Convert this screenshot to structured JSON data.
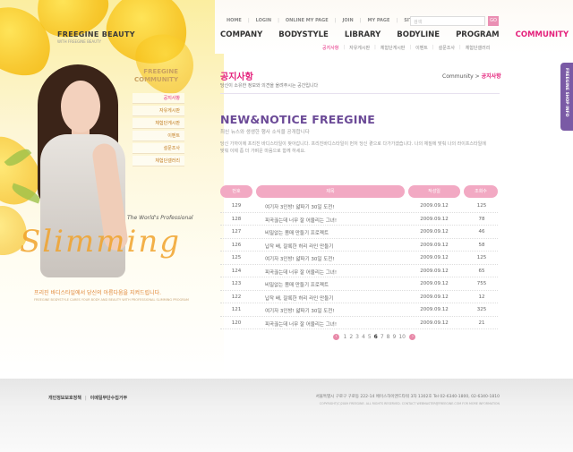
{
  "brand": {
    "name": "FREEGINE BEAUTY",
    "tagline": "WITH FREEGINE BEAUTY"
  },
  "util_nav": [
    "HOME",
    "LOGIN",
    "ONLINE MY PAGE",
    "JOIN",
    "MY PAGE",
    "SITEMAP"
  ],
  "search": {
    "placeholder": "검색",
    "button": "GO"
  },
  "main_nav": [
    {
      "label": "COMPANY",
      "active": false
    },
    {
      "label": "BODYSTYLE",
      "active": false
    },
    {
      "label": "LIBRARY",
      "active": false
    },
    {
      "label": "BODYLINE",
      "active": false
    },
    {
      "label": "PROGRAM",
      "active": false
    },
    {
      "label": "COMMUNITY",
      "active": true
    }
  ],
  "sub_nav": [
    {
      "label": "공지사항",
      "active": true
    },
    {
      "label": "자유게시판",
      "active": false
    },
    {
      "label": "체험단게시판",
      "active": false
    },
    {
      "label": "이벤트",
      "active": false
    },
    {
      "label": "설문조사",
      "active": false
    },
    {
      "label": "체험단갤러리",
      "active": false
    }
  ],
  "community": {
    "title_line1": "FREEGINE",
    "title_line2": "COMMUNITY",
    "menu": [
      {
        "label": "공지사항",
        "active": true
      },
      {
        "label": "자유게시판",
        "active": false
      },
      {
        "label": "체험단게시판",
        "active": false
      },
      {
        "label": "이벤트",
        "active": false
      },
      {
        "label": "설문조사",
        "active": false
      },
      {
        "label": "체험단갤러리",
        "active": false
      }
    ]
  },
  "slimming": {
    "small": "The World's Professional",
    "big": "Slimming",
    "caption": "프리진 바디스타일에서 당신의 아름다움을 지켜드립니다.",
    "caption_sub": "FREEGINE BODYSTYLE CARES YOUR BODY AND BEAUTY WITH PROFESSIONAL SLIMMING PROGRAM"
  },
  "page": {
    "title": "공지사항",
    "subtitle": "당신이 소유한 정보와 의견을 올려주시는 공간입니다",
    "breadcrumb_parent": "Community",
    "breadcrumb_sep": ">",
    "breadcrumb_current": "공지사항"
  },
  "notice": {
    "title": "NEW&NOTICE FREEGINE",
    "subtitle": "최신 뉴스와 생생한 행사 소식을 공개합니다",
    "desc": "당신 가까이에 프리진 바디스타일이 찾아갑니다. 프리진바디스타일이 먼저 당신 곁으로 다가가겠습니다. 나의 체질에 맞춰 나의 라이프스타일에 맞춰 이제 좀 더 가벼운 마음으로 함께 하세요."
  },
  "table": {
    "headers": {
      "no": "번호",
      "title": "제목",
      "date": "작성일",
      "views": "조회수"
    },
    "rows": [
      {
        "no": "129",
        "title": "여기자 3인방! 얇파기 30일 도전!",
        "date": "2009.09.12",
        "views": "125"
      },
      {
        "no": "128",
        "title": "피곡끊는데 너무 잘 어울리는 그녀!",
        "date": "2009.09.12",
        "views": "78"
      },
      {
        "no": "127",
        "title": "비밀없는 몸매 만들기 프로젝트",
        "date": "2009.09.12",
        "views": "46"
      },
      {
        "no": "126",
        "title": "납작 배, 잘록한 허리 라인 만들기",
        "date": "2009.09.12",
        "views": "58"
      },
      {
        "no": "125",
        "title": "여기자 3인방! 얇파기 30일 도전!",
        "date": "2009.09.12",
        "views": "125"
      },
      {
        "no": "124",
        "title": "피곡끊는데 너무 잘 어울리는 그녀!",
        "date": "2009.09.12",
        "views": "65"
      },
      {
        "no": "123",
        "title": "비밀없는 몸매 만들기 프로젝트",
        "date": "2009.09.12",
        "views": "755"
      },
      {
        "no": "122",
        "title": "납작 배, 잘록한 허리 라인 만들기",
        "date": "2009.09.12",
        "views": "12"
      },
      {
        "no": "121",
        "title": "여기자 3인방! 얇파기 30일 도전!",
        "date": "2009.09.12",
        "views": "325"
      },
      {
        "no": "120",
        "title": "피곡끊는데 너무 잘 어울리는 그녀!",
        "date": "2009.09.12",
        "views": "21"
      }
    ]
  },
  "pager": {
    "prev": "‹",
    "next": "›",
    "pages": [
      "1",
      "2",
      "3",
      "4",
      "5",
      "6",
      "7",
      "8",
      "9",
      "10"
    ],
    "current": "6"
  },
  "side_tab": "FREEGINE SHOP INFO",
  "footer": {
    "link1": "개인정보보호정책",
    "sep": "|",
    "link2": "이메일무단수집거부",
    "address": "서울특별시 구로구 구로동 222-14 에이스하이엔드타워 3차 1302호   Tel 02-6340-1800, 02-6340-1810",
    "copyright": "COPYRIGHT(C)2009 FREEGINE. ALL RIGHTS RESERVED. CONTACT WEBMASTER@FREEGINE.COM FOR MORE INFORMATION"
  },
  "colors": {
    "accent": "#e4207b",
    "purple": "#6b4a97",
    "table_head": "#f2a9c3"
  }
}
